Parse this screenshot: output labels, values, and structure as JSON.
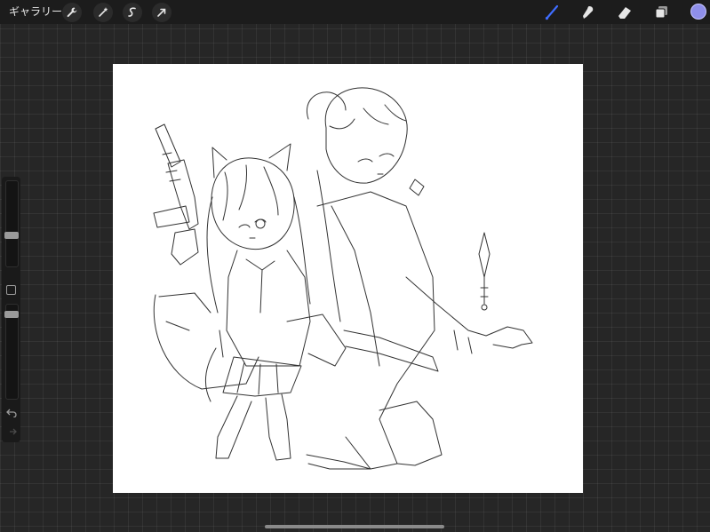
{
  "topbar": {
    "gallery_label": "ギャラリー",
    "left_tools": [
      "wrench-icon",
      "magic-wand-icon",
      "selection-icon",
      "transform-icon"
    ],
    "right_tools": [
      "brush-icon",
      "smudge-icon",
      "eraser-icon",
      "layers-icon"
    ],
    "active_tool": "brush-icon",
    "current_color": "#8f8fea",
    "accent_color": "#3f6dff"
  },
  "sidebar": {
    "brush_size_level": 0.35,
    "opacity_level": 0.05,
    "tools": [
      "modify-button",
      "undo-icon",
      "redo-icon"
    ]
  },
  "canvas": {
    "background": "#ffffff",
    "content": "line-art-drawing"
  }
}
